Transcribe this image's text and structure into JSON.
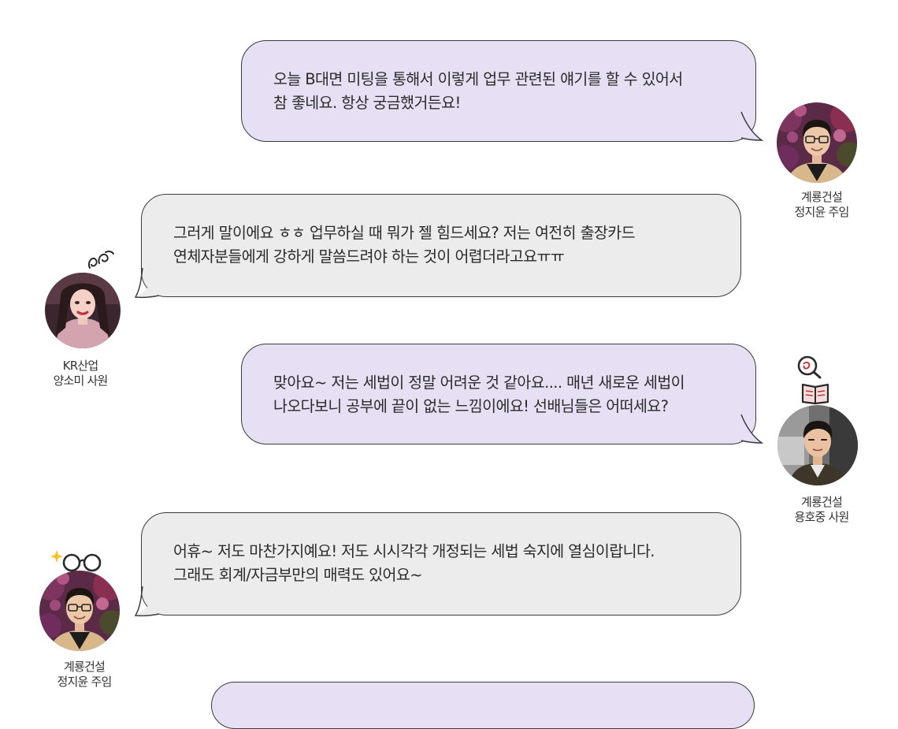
{
  "messages": [
    {
      "lines": [
        "오늘 B대면 미팅을 통해서 이렇게 업무 관련된 얘기를 할 수 있어서",
        "참 좋네요. 항상 궁금했거든요!"
      ],
      "speaker": {
        "company": "계룡건설",
        "name": "정지윤 주임"
      },
      "color": "#e7dff3"
    },
    {
      "lines": [
        "그러게 말이에요 ㅎㅎ 업무하실 때 뭐가 젤 힘드세요? 저는 여전히 출장카드",
        "연체자분들에게 강하게 말씀드려야 하는 것이 어렵더라고요ㅠㅠ"
      ],
      "speaker": {
        "company": "KR산업",
        "name": "양소미 사원"
      },
      "color": "#ececec"
    },
    {
      "lines": [
        "맞아요~ 저는 세법이 정말 어려운 것 같아요....  매년 새로운 세법이",
        "나오다보니 공부에 끝이 없는 느낌이에요!  선배님들은 어떠세요?"
      ],
      "speaker": {
        "company": "계룡건설",
        "name": "용호중 사원"
      },
      "color": "#e7dff3"
    },
    {
      "lines": [
        "어휴~ 저도 마찬가지예요! 저도 시시각각 개정되는 세법 숙지에 열심이랍니다.",
        "그래도 회계/자금부만의 매력도 있어요~"
      ],
      "speaker": {
        "company": "계룡건설",
        "name": "정지윤 주임"
      },
      "color": "#ececec"
    }
  ],
  "icons": {
    "squiggle": "squiggle-doodle-icon",
    "magnifier_book": "magnifier-book-icon",
    "glasses_sparkle": "glasses-sparkle-icon"
  },
  "colors": {
    "bubble_border": "#3c3c3c",
    "purple_bubble": "#e7dff3",
    "gray_bubble": "#ececec",
    "text": "#2b2b2b"
  }
}
